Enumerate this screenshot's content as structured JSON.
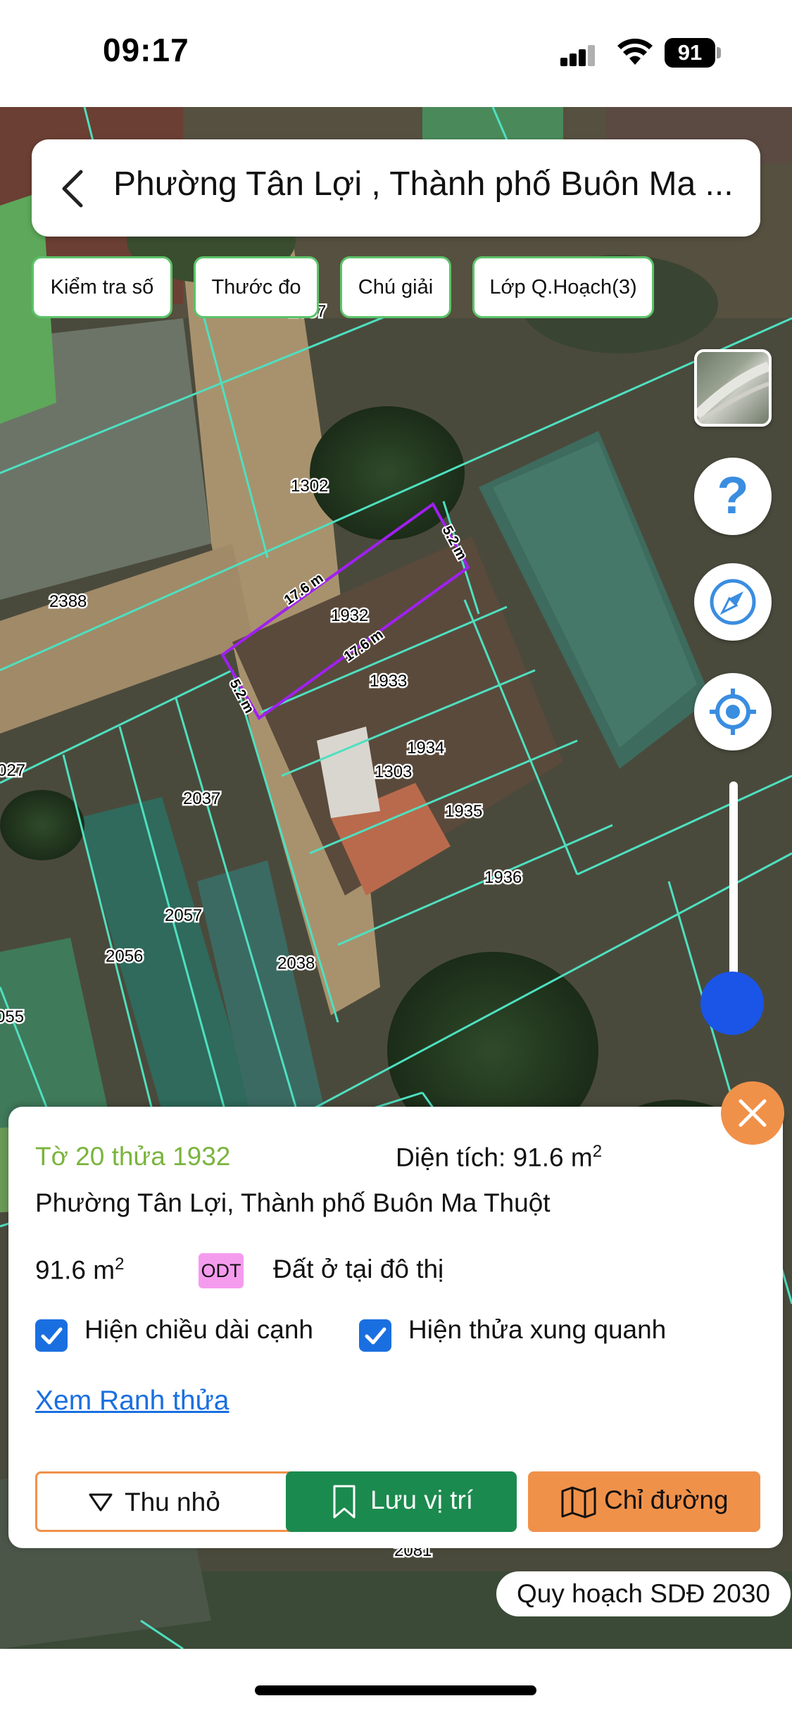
{
  "status_bar": {
    "time": "09:17",
    "battery": "91",
    "icons": [
      "signal-icon",
      "wifi-icon",
      "battery-icon"
    ]
  },
  "header": {
    "title": "Phường Tân Lợi , Thành phố Buôn Ma ...",
    "back_icon": "chevron-left-icon"
  },
  "chips": [
    {
      "label": "Kiểm tra số"
    },
    {
      "label": "Thước đo"
    },
    {
      "label": "Chú giải"
    },
    {
      "label": "Lớp Q.Hoạch(3)"
    }
  ],
  "controls": {
    "help_glyph": "?",
    "icons": [
      "layer-thumbnail-icon",
      "help-icon",
      "compass-icon",
      "locate-icon",
      "zoom-slider"
    ],
    "zoom_level": 0.15,
    "accent": "#3a8de0"
  },
  "map": {
    "parcels": [
      "2087",
      "1302",
      "2388",
      "1932",
      "1933",
      "1934",
      "1303",
      "1935",
      "1936",
      "2037",
      "2057",
      "2056",
      "2038",
      "027",
      "055",
      "2081"
    ],
    "edge_lengths": [
      "17.6 m",
      "5.2 m",
      "17.6 m",
      "5.2 m"
    ],
    "boundary_color": "#4ee0c0",
    "selected_color": "#a020f0"
  },
  "info_card": {
    "parcel_id": "Tờ 20 thửa 1932",
    "area_label": "Diện tích: 91.6 m",
    "area_unit_sup": "2",
    "address": "Phường Tân Lợi, Thành phố Buôn Ma Thuột",
    "area_value": "91.6 m",
    "area_value_sup": "2",
    "land_code": "ODT",
    "land_use": "Đất ở tại đô thị",
    "checkbox_edges": "Hiện chiều dài cạnh",
    "checkbox_edges_checked": true,
    "checkbox_surround": "Hiện thửa xung quanh",
    "checkbox_surround_checked": true,
    "boundary_link": "Xem Ranh thửa",
    "minimize": "Thu nhỏ",
    "save": "Lưu vị trí",
    "directions": "Chỉ đường",
    "colors": {
      "green_text": "#7ab43c",
      "save_bg": "#1b8a4e",
      "orange": "#f0914a",
      "link": "#1a6fe0",
      "code_bg": "#f59bee"
    }
  },
  "planning_badge": "Quy hoạch SDĐ 2030"
}
